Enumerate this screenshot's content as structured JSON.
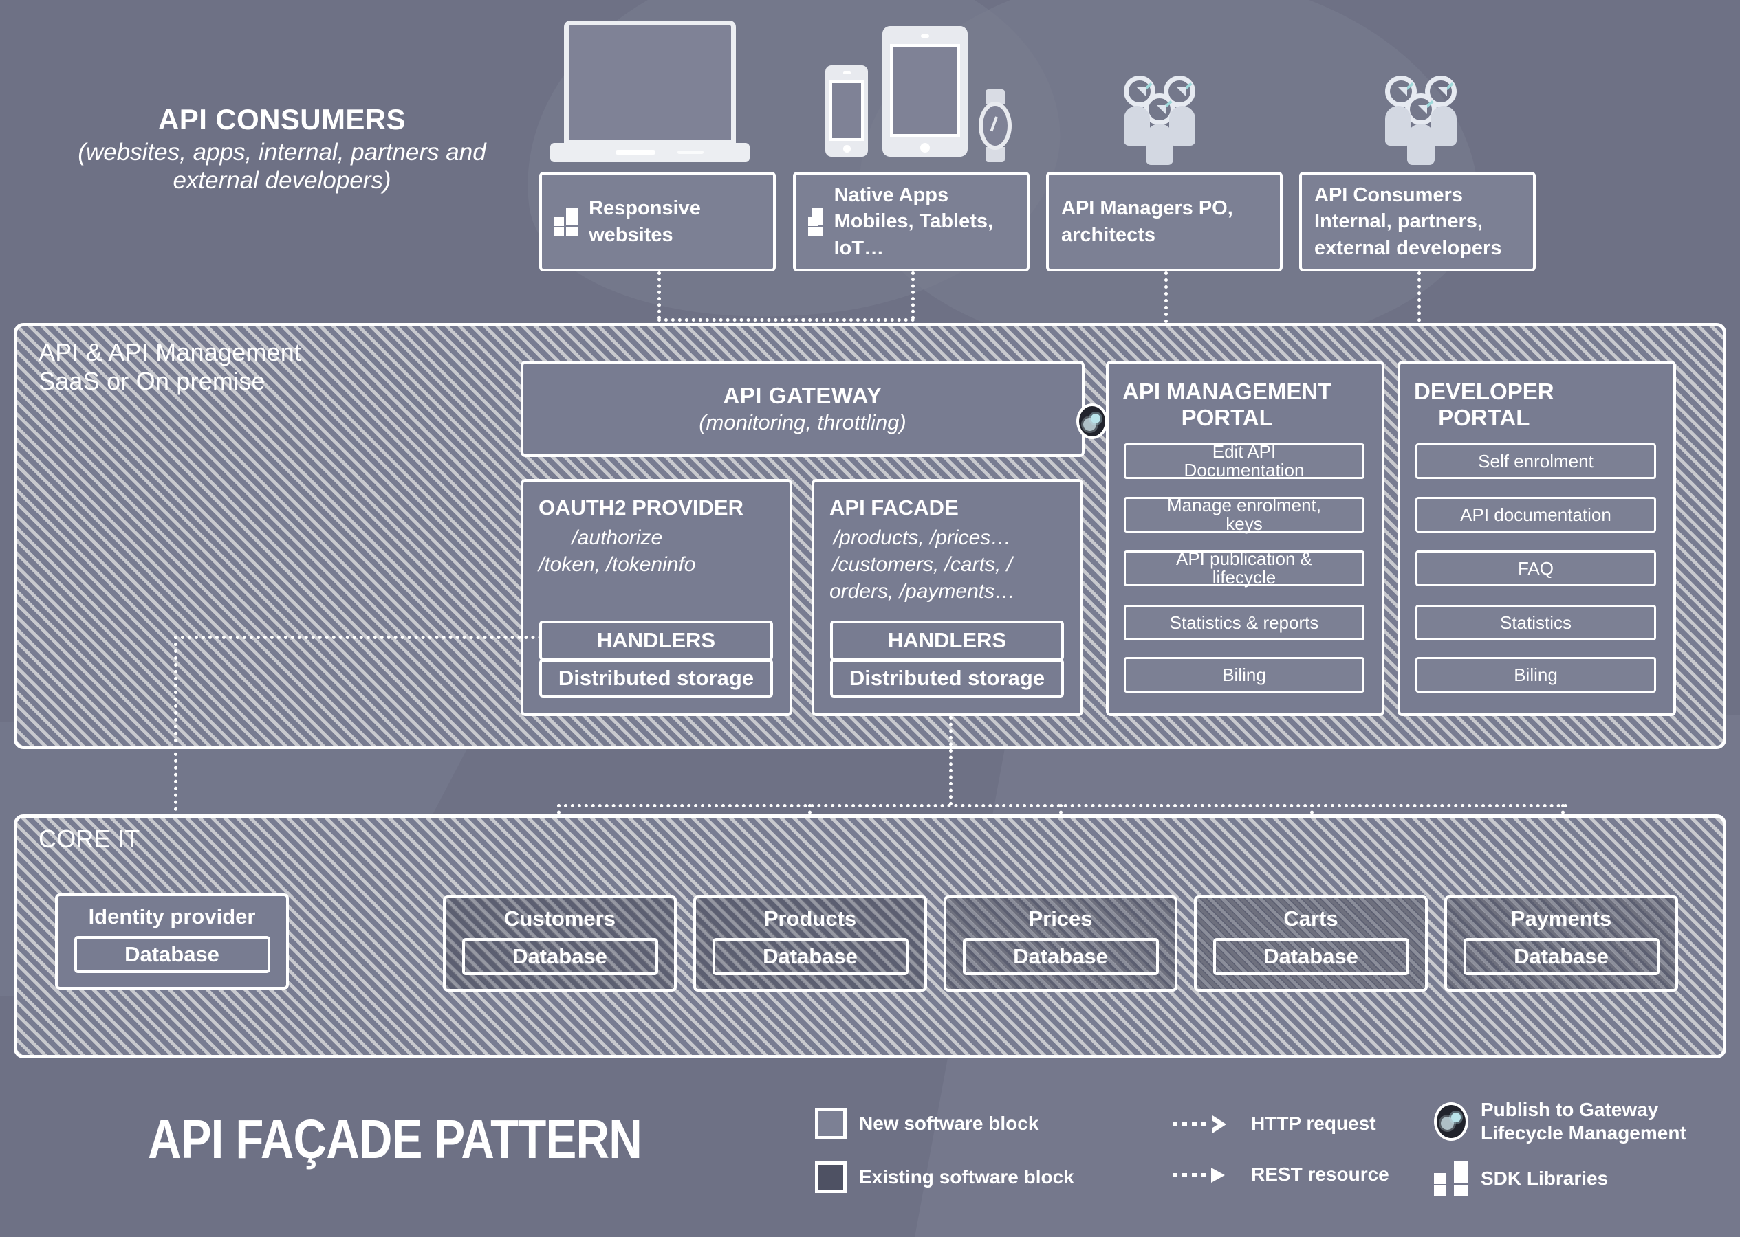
{
  "headline": {
    "title": "API CONSUMERS",
    "subtitle": "(websites, apps, internal, partners\nand external developers)"
  },
  "consumers": [
    {
      "name": "responsive-websites",
      "label": "Responsive\nwebsites",
      "icon": "sdk-icon"
    },
    {
      "name": "native-apps",
      "label": "Native Apps\nMobiles,\nTablets, IoT…",
      "icon": "sdk-icon"
    },
    {
      "name": "api-managers",
      "label": "API Managers\nPO, architects",
      "icon": "none"
    },
    {
      "name": "api-consumers",
      "label": "API Consumers\nInternal, partners,\nexternal developers",
      "icon": "none"
    }
  ],
  "api_layer": {
    "title": "API & API Management\nSaaS or On premise",
    "gateway": {
      "title": "API GATEWAY",
      "subtitle": "(monitoring, throttling)",
      "badge_icon": "publish-gateway-icon"
    },
    "oauth2": {
      "title": "OAUTH2 PROVIDER",
      "endpoints": "/authorize\n/token, /tokeninfo",
      "handlers": "HANDLERS",
      "storage": "Distributed storage"
    },
    "facade": {
      "title": "API FACADE",
      "endpoints": "/products, /prices…\n/customers, /carts, /\norders, /payments…",
      "handlers": "HANDLERS",
      "storage": "Distributed storage"
    },
    "management_portal": {
      "title": "API MANAGEMENT\nPORTAL",
      "items": [
        "Edit API\nDocumentation",
        "Manage enrolment,\nkeys",
        "API publication &\nlifecycle",
        "Statistics & reports",
        "Biling"
      ]
    },
    "developer_portal": {
      "title": "DEVELOPER\nPORTAL",
      "items": [
        "Self enrolment",
        "API documentation",
        "FAQ",
        "Statistics",
        "Biling"
      ]
    }
  },
  "core_it": {
    "title": "CORE IT",
    "identity": {
      "label": "Identity provider",
      "database": "Database",
      "kind": "new"
    },
    "systems": [
      {
        "label": "Customers",
        "database": "Database",
        "kind": "existing"
      },
      {
        "label": "Products",
        "database": "Database",
        "kind": "existing"
      },
      {
        "label": "Prices",
        "database": "Database",
        "kind": "existing"
      },
      {
        "label": "Carts",
        "database": "Database",
        "kind": "existing"
      },
      {
        "label": "Payments",
        "database": "Database",
        "kind": "existing"
      }
    ]
  },
  "footer": {
    "title": "API FAÇADE PATTERN",
    "legend": [
      {
        "name": "new-software-block",
        "label": "New software block",
        "icon": "swatch-new"
      },
      {
        "name": "existing-software-block",
        "label": "Existing software block",
        "icon": "swatch-old"
      },
      {
        "name": "http-request",
        "label": "HTTP request",
        "icon": "dotted-chevron-arrow-icon"
      },
      {
        "name": "rest-resource",
        "label": "REST resource",
        "icon": "dotted-triangle-arrow-icon"
      },
      {
        "name": "publish-to-gateway",
        "label": "Publish to Gateway\nLifecycle Management",
        "icon": "gear-badge-icon"
      },
      {
        "name": "sdk-libraries",
        "label": "SDK Libraries",
        "icon": "sdk-icon"
      }
    ]
  },
  "colors": {
    "background": "#6e7185",
    "hatch_base": "#787c91",
    "hatch_stripe": "#c8c9ce",
    "new_block": "#7c8094",
    "existing_block": "#4e5163",
    "stroke": "#ffffff"
  }
}
